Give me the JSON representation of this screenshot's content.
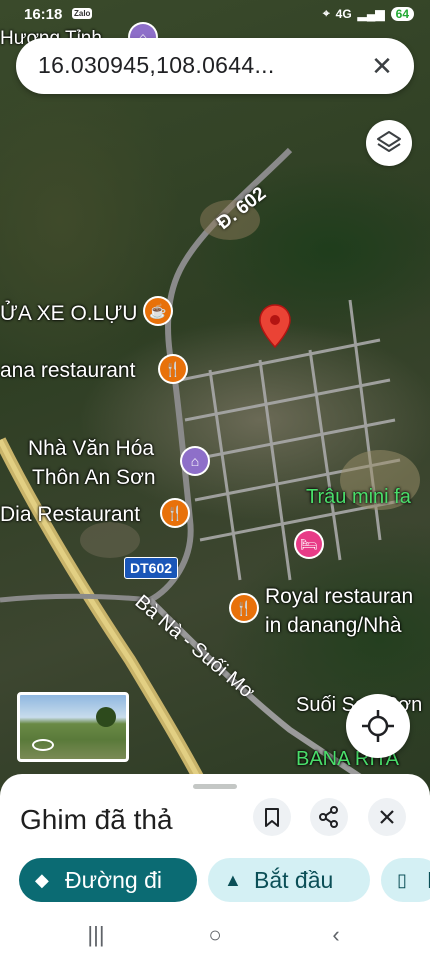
{
  "status_bar": {
    "time": "16:18",
    "app_badge": "Zalo",
    "network": "4G",
    "battery": "64"
  },
  "search": {
    "coords": "16.030945,108.0644..."
  },
  "map": {
    "labels": {
      "huong_tinh": "Hương Tỉnh",
      "road_602": "Đ. 602",
      "sua_xe": "ỬA XE O.LỰU",
      "ana_restaurant": "ana restaurant",
      "nha_van_hoa_1": "Nhà Văn Hóa",
      "nha_van_hoa_2": "Thôn An Sơn",
      "dia_restaurant": "Dia Restaurant",
      "trau_mini": "Trâu mini fa",
      "dt602": "DT602",
      "ba_na_road": "Bà Nà - Suối Mơ",
      "royal_1": "Royal restauran",
      "royal_2": "in danang/Nhà",
      "suoi_son": "Suối Sơn Sơn",
      "bana_rita": "BANA RITA"
    }
  },
  "sheet": {
    "title": "Ghim đã thả",
    "directions_label": "Đường đi",
    "start_label": "Bắt đầu",
    "third_label": "L"
  },
  "colors": {
    "primary_button": "#0b6b73",
    "secondary_button": "#d4f0f4",
    "pin": "#ea4335",
    "poi_orange": "#e8710a",
    "poi_purple": "#8e6fc9",
    "poi_pink": "#e83b87"
  }
}
